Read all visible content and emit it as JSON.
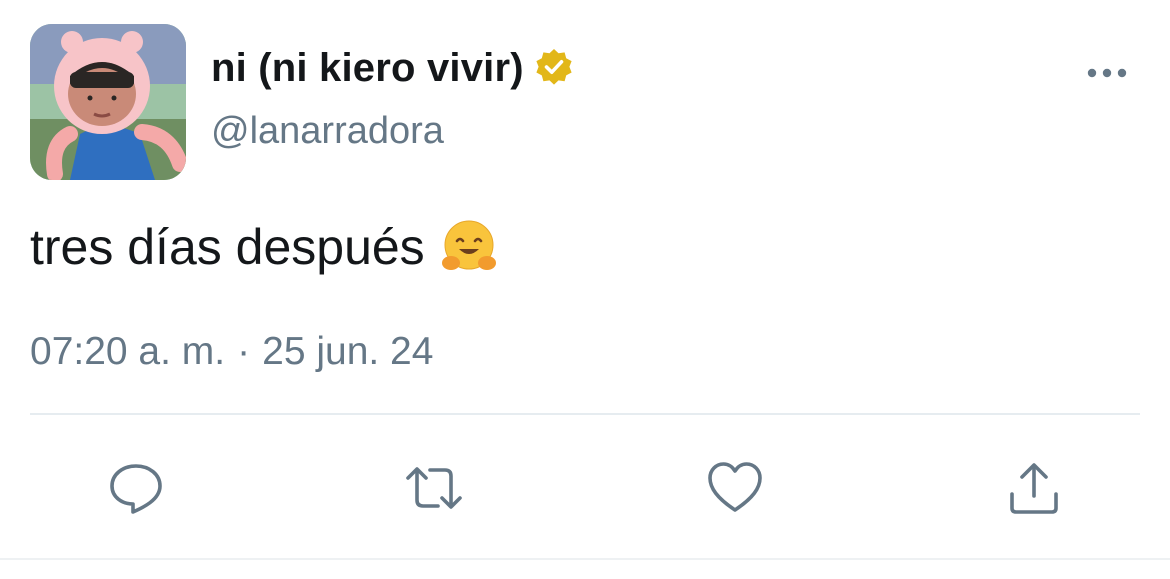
{
  "author": {
    "display_name": "ni (ni kiero vivir)",
    "handle": "@lanarradora",
    "verified": true,
    "avatar_icon": "cartoon-hat-avatar"
  },
  "tweet": {
    "text": "tres días después",
    "emoji": "hugging-face-emoji"
  },
  "meta": {
    "time": "07:20 a. m.",
    "separator": "·",
    "date": "25 jun. 24"
  },
  "actions": [
    {
      "name": "reply",
      "icon": "speech-bubble-icon"
    },
    {
      "name": "retweet",
      "icon": "retweet-icon"
    },
    {
      "name": "like",
      "icon": "heart-icon"
    },
    {
      "name": "share",
      "icon": "share-icon"
    }
  ],
  "colors": {
    "text": "#14171a",
    "secondary": "#657786",
    "icon": "#657786",
    "badge": "#e2b719",
    "divider": "#e6ecf0"
  }
}
